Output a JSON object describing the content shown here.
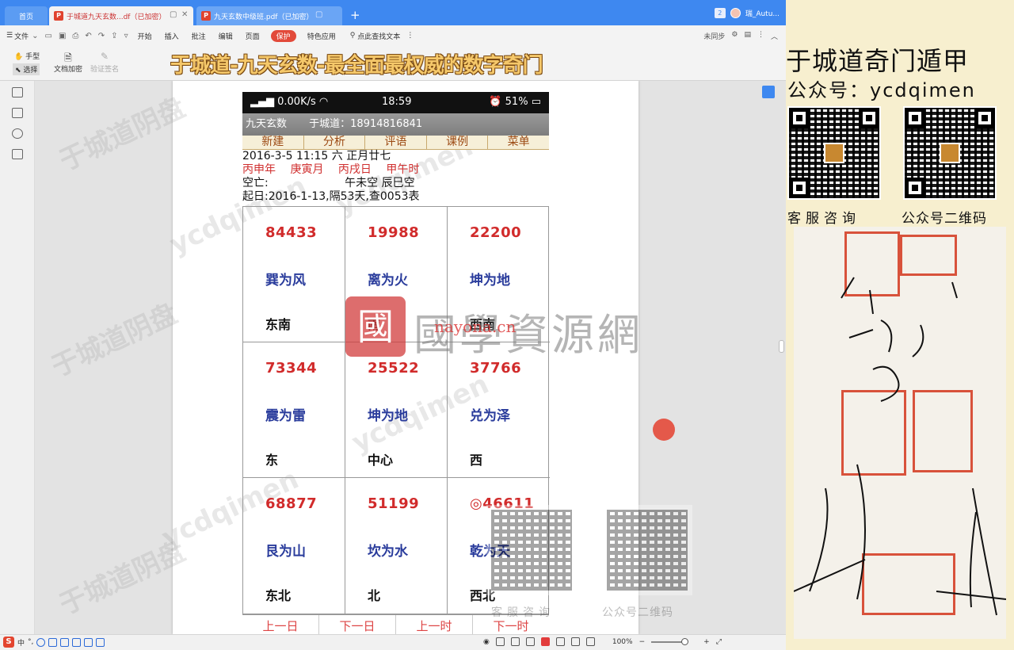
{
  "tabs": {
    "home": "首页",
    "active": "于城道九天玄数...df（已加密）",
    "inactive": "九天玄数中级班.pdf（已加密）",
    "account": "瑞_Autu..."
  },
  "menu": {
    "file": "文件",
    "items": [
      "开始",
      "插入",
      "批注",
      "编辑",
      "页面"
    ],
    "protect": "保护",
    "special": "特色应用",
    "search": "点此查找文本",
    "sync": "未同步"
  },
  "toolbar": {
    "hand": "手型",
    "select": "选择",
    "encrypt": "文档加密",
    "verify": "验证签名",
    "overlay_title": "于城道-九天玄数-最全面最权威的数字奇门"
  },
  "phone": {
    "status_left": "0.00K/s",
    "time": "18:59",
    "battery": "51%",
    "app_name": "九天玄数",
    "author": "于城道：18914816841",
    "nav": [
      "新建",
      "分析",
      "评语",
      "课例",
      "菜单"
    ],
    "date_line": "2016-3-5 11:15 六 正月廿七",
    "ganzhi": [
      "丙申年",
      "庚寅月",
      "丙戌日",
      "甲午时"
    ],
    "kongwang_label": "空亡:",
    "kongwang_values": "午未空  辰巳空",
    "start_line": "起日:2016-1-13,隔53天,查0053表",
    "cells": [
      {
        "num": "84433",
        "hex": "巽为风",
        "dir": "东南"
      },
      {
        "num": "19988",
        "hex": "离为火",
        "dir": "南"
      },
      {
        "num": "22200",
        "hex": "坤为地",
        "dir": "西南"
      },
      {
        "num": "73344",
        "hex": "震为雷",
        "dir": "东"
      },
      {
        "num": "25522",
        "hex": "坤为地",
        "dir": "中心"
      },
      {
        "num": "37766",
        "hex": "兑为泽",
        "dir": "西"
      },
      {
        "num": "68877",
        "hex": "艮为山",
        "dir": "东北"
      },
      {
        "num": "51199",
        "hex": "坎为水",
        "dir": "北"
      },
      {
        "num": "◎46611",
        "hex": "乾为天",
        "dir": "西北"
      }
    ],
    "bottom_nav": [
      "上一日",
      "下一日",
      "上一时",
      "下一时"
    ]
  },
  "watermark": {
    "site_text": "國學資源網",
    "site_url": "nayona.cn",
    "seal_char": "國",
    "qr_captions": [
      "客服咨询",
      "公众号二维码"
    ]
  },
  "statusbar": {
    "ime": "中",
    "zoom": "100%"
  },
  "right_panel": {
    "title": "于城道奇门遁甲",
    "gongzhonghao": "公众号：ycdqimen",
    "qr_left_caption": "客服咨询",
    "qr_right_caption": "公众号二维码"
  },
  "colors": {
    "tab_blue": "#3e88f0",
    "number_red": "#d12b2b",
    "hexagram_blue": "#2a3c9c",
    "seal_red": "#d8523b",
    "panel_bg": "#f7efcf"
  }
}
